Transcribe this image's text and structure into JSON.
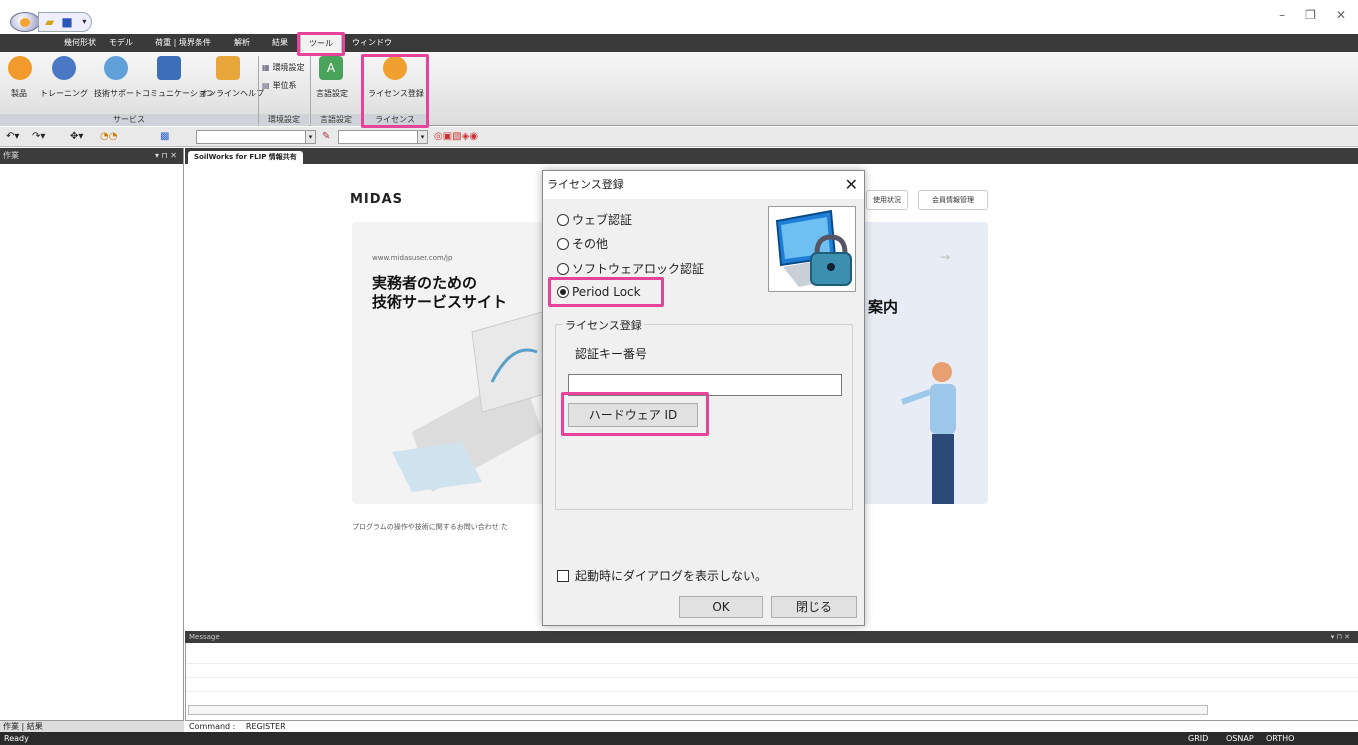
{
  "quick_access": {
    "icons": [
      "open-folder-icon",
      "save-icon",
      "dropdown-icon"
    ]
  },
  "window_controls": {
    "minimize": "–",
    "restore": "❐",
    "close": "✕"
  },
  "ribbon_tabs": [
    {
      "label": "幾何形状"
    },
    {
      "label": "モデル"
    },
    {
      "label": "荷重 | 境界条件"
    },
    {
      "label": "解析"
    },
    {
      "label": "結果"
    },
    {
      "label": "ツール"
    },
    {
      "label": "ウィンドウ"
    }
  ],
  "ribbon": {
    "service_buttons": [
      "製品",
      "トレーニング",
      "技術サポート",
      "コミュニケーション",
      "オンラインヘルプ"
    ],
    "env_small_buttons": [
      "環境設定",
      "単位系"
    ],
    "language_button": "言語設定",
    "license_button": "ライセンス登録",
    "group_labels": [
      "サービス",
      "環境設定",
      "言語設定",
      "ライセンス"
    ]
  },
  "left_panel": {
    "title": "作業",
    "controls": "▾ ⊓ ✕",
    "tabs": "作業 | 結果"
  },
  "doc_tab": "SoilWorks for FLIP 情報共有",
  "webpage": {
    "logo": "MIDAS",
    "url": "www.midasuser.com/jp",
    "headline_1": "実務者のための",
    "headline_2": "技術サービスサイト",
    "btn_usage": "使用状況",
    "btn_member": "会員情報管理",
    "arrow": "→",
    "right_text": "案内",
    "footnote": "プログラムの操作や技術に関するお問い合わせ た"
  },
  "message_panel": {
    "title": "Message",
    "controls": "▾ ⊓ ✕"
  },
  "command_line": {
    "label": "Command :",
    "value": "REGISTER"
  },
  "status_bar": {
    "left": "Ready",
    "grid": "GRID",
    "osnap": "OSNAP",
    "ortho": "ORTHO"
  },
  "dialog": {
    "title": "ライセンス登録",
    "close": "✕",
    "options": [
      {
        "label": "ウェブ認証",
        "selected": false
      },
      {
        "label": "その他",
        "selected": false
      },
      {
        "label": "ソフトウェアロック認証",
        "selected": false
      },
      {
        "label": "Period Lock",
        "selected": true
      }
    ],
    "group_label": "ライセンス登録",
    "key_label": "認証キー番号",
    "key_value": "",
    "hardware_button": "ハードウェア ID",
    "checkbox_label": "起動時にダイアログを表示しない。",
    "checkbox_checked": false,
    "ok": "OK",
    "close_button": "閉じる"
  },
  "colors": {
    "highlight": "#e8439b",
    "tabbar": "#3a3a3a",
    "accent_blue": "#1f7fd6"
  }
}
